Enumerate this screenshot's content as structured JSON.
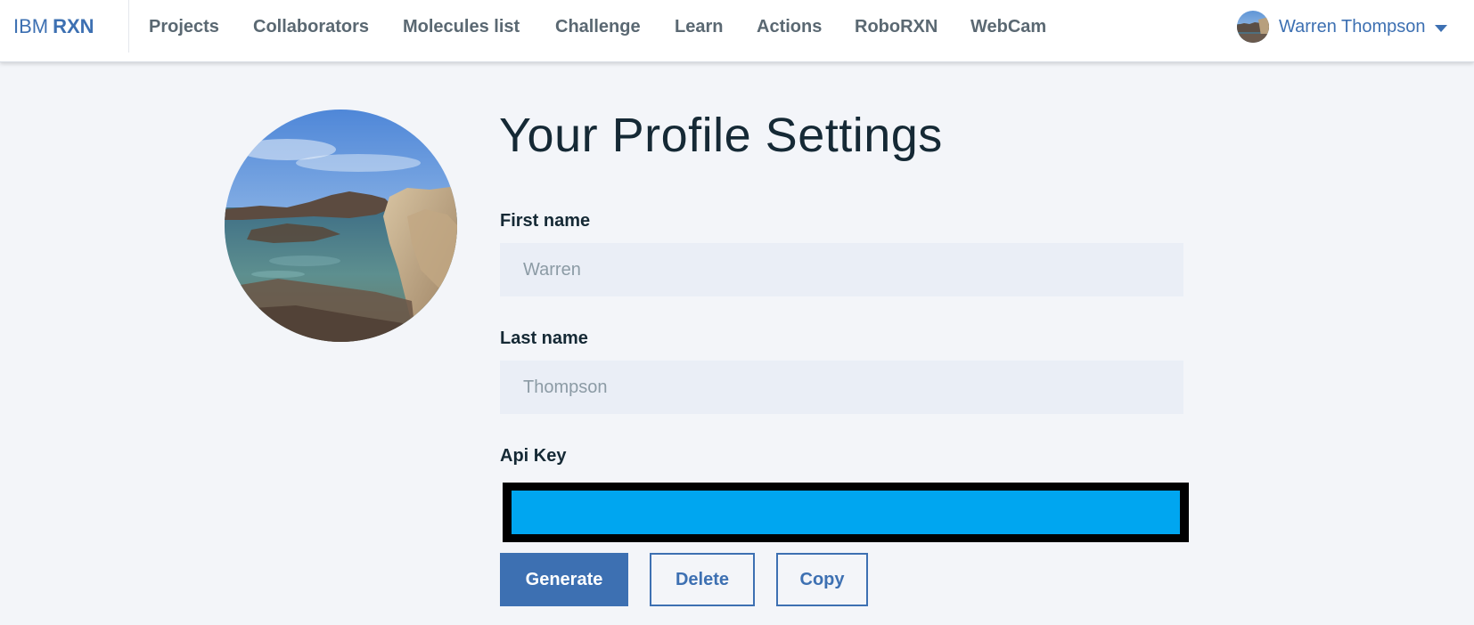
{
  "brand": {
    "prefix": "IBM",
    "name": "RXN"
  },
  "nav": {
    "items": [
      {
        "label": "Projects"
      },
      {
        "label": "Collaborators"
      },
      {
        "label": "Molecules list"
      },
      {
        "label": "Challenge"
      },
      {
        "label": "Learn"
      },
      {
        "label": "Actions"
      },
      {
        "label": "RoboRXN"
      },
      {
        "label": "WebCam"
      }
    ]
  },
  "user": {
    "name": "Warren Thompson"
  },
  "profile": {
    "title": "Your Profile Settings",
    "first_name": {
      "label": "First name",
      "value": "Warren"
    },
    "last_name": {
      "label": "Last name",
      "value": "Thompson"
    },
    "api_key": {
      "label": "Api Key"
    }
  },
  "actions": {
    "generate_label": "Generate",
    "delete_label": "Delete",
    "copy_label": "Copy"
  },
  "colors": {
    "accent": "#3d70b2",
    "page_background": "#f3f5f9",
    "input_background": "#eaeef6",
    "api_key_highlight": "#00a6f0"
  },
  "icons": {
    "user_menu_caret": "chevron-down-icon"
  }
}
